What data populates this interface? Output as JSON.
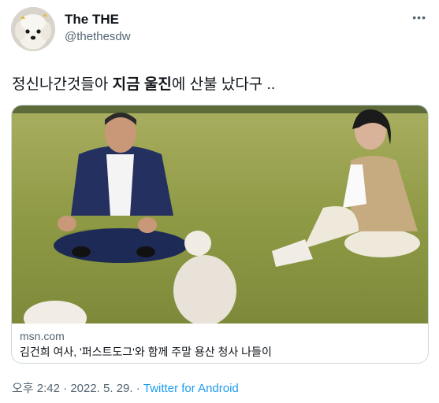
{
  "author": {
    "display_name": "The THE",
    "handle": "@thethesdw",
    "avatar_icon": "dog-avatar-icon"
  },
  "more_icon": "more-options-icon",
  "tweet": {
    "text_part1": "정신나간것들아 ",
    "text_bold": "지금 울진",
    "text_part2": "에 산불 났다구 .."
  },
  "card": {
    "domain": "msn.com",
    "title": "김건희 여사, '퍼스트도그'와 함께 주말 용산 청사 나들이"
  },
  "meta": {
    "time": "오후 2:42",
    "separator": " · ",
    "date": "2022. 5. 29.",
    "source": "Twitter for Android"
  },
  "colors": {
    "text": "#0f1419",
    "secondary": "#536471",
    "link": "#1d9bf0",
    "border": "#cfd9de"
  }
}
